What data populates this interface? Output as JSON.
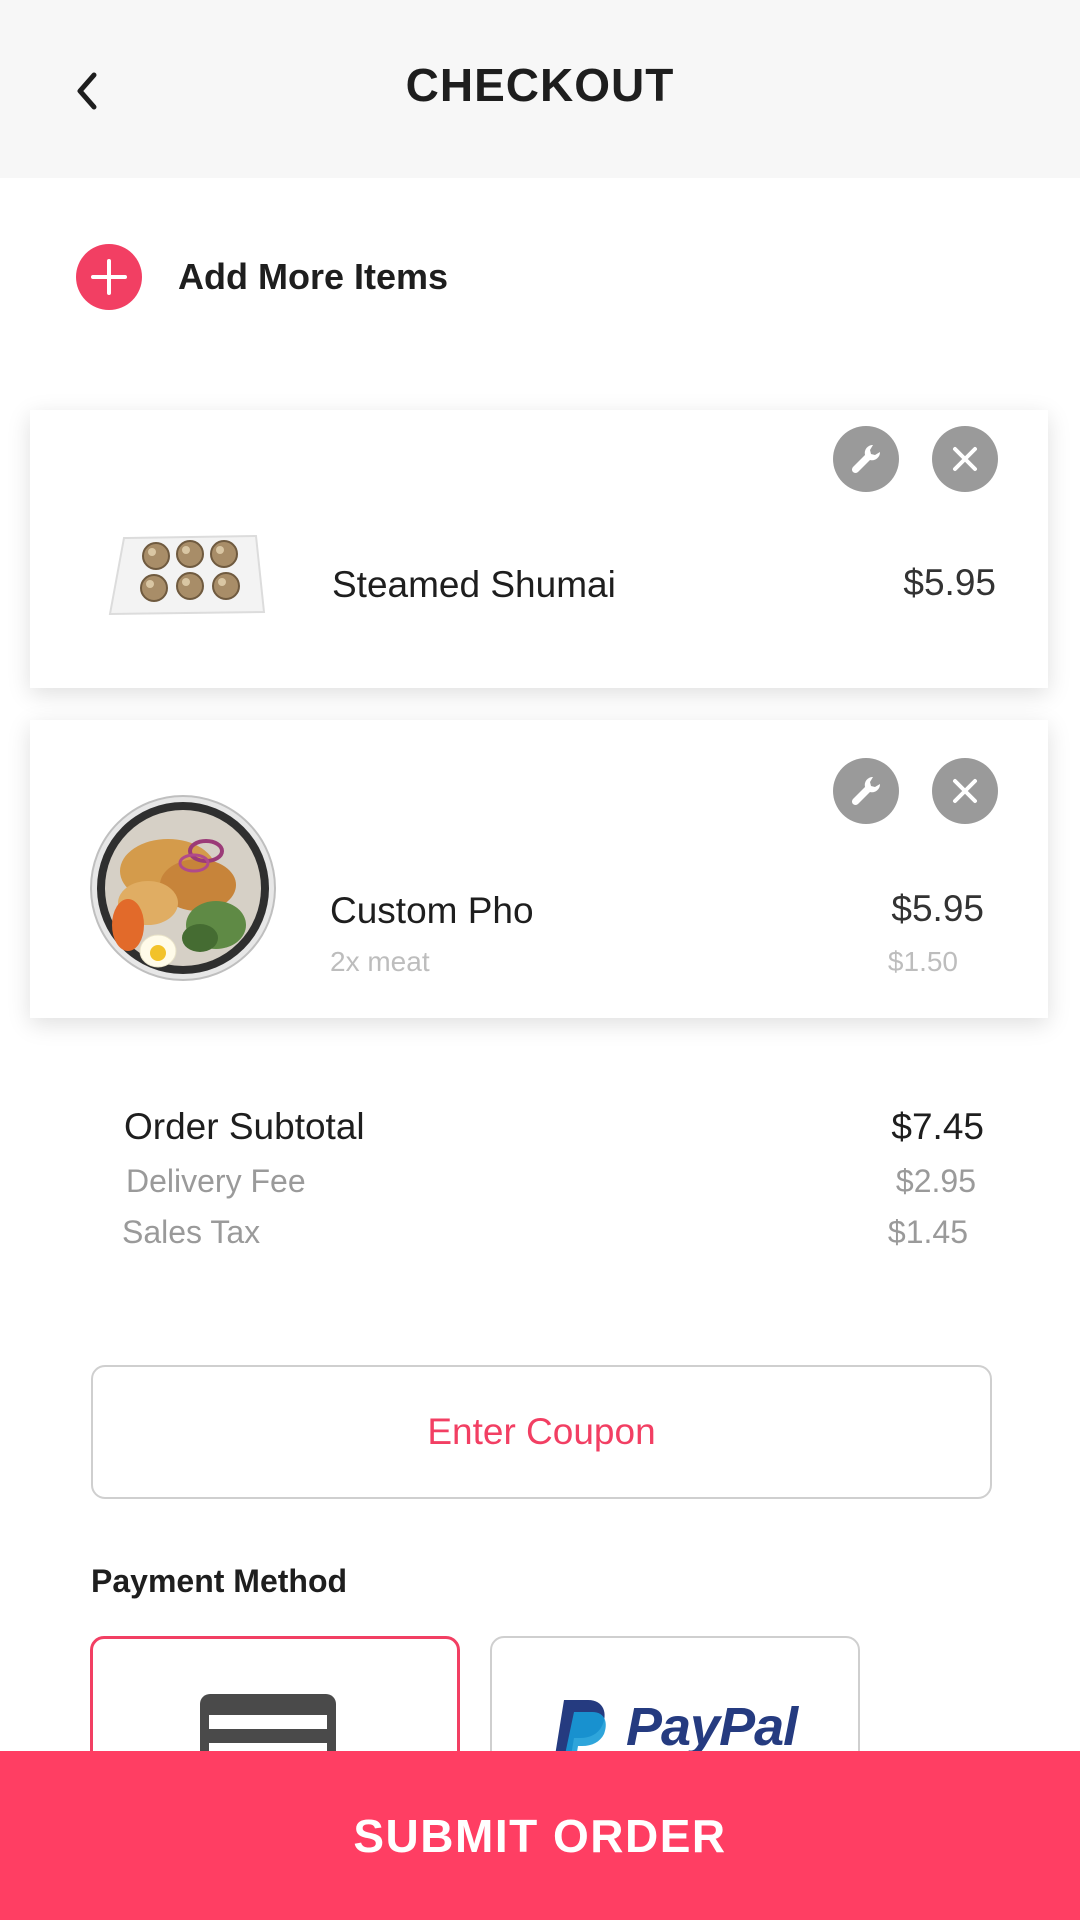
{
  "header": {
    "title": "CHECKOUT"
  },
  "add_more": {
    "label": "Add More Items"
  },
  "cart": {
    "items": [
      {
        "name": "Steamed Shumai",
        "price": "$5.95"
      },
      {
        "name": "Custom Pho",
        "price": "$5.95",
        "modifier": "2x meat",
        "modifier_price": "$1.50"
      }
    ]
  },
  "totals": {
    "subtotal_label": "Order Subtotal",
    "subtotal_value": "$7.45",
    "delivery_label": "Delivery Fee",
    "delivery_value": "$2.95",
    "tax_label": "Sales Tax",
    "tax_value": "$1.45"
  },
  "coupon": {
    "label": "Enter Coupon"
  },
  "payment": {
    "label": "Payment Method",
    "options": [
      {
        "type": "credit-card",
        "selected": true
      },
      {
        "type": "paypal",
        "text": "PayPal",
        "selected": false
      }
    ]
  },
  "submit": {
    "label": "SUBMIT ORDER"
  },
  "colors": {
    "accent": "#ff3e63",
    "icon_gray": "#9a9a9a",
    "header_bg": "#f7f7f7"
  }
}
